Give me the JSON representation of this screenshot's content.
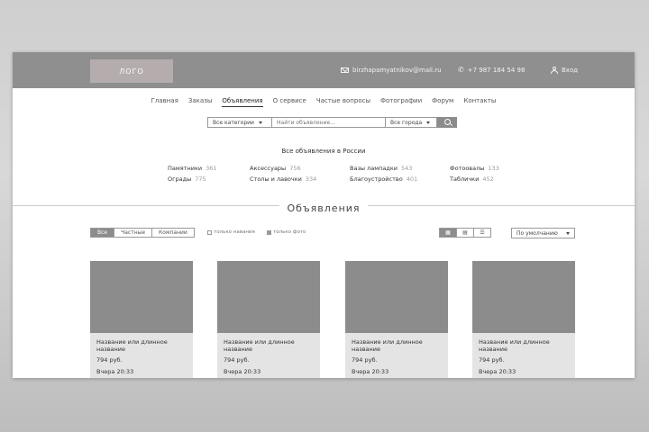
{
  "header": {
    "logo": "ЛОГО",
    "email": "birzhapamyatnikov@mail.ru",
    "phone": "+7 987 184 54 98",
    "login": "Вход"
  },
  "nav": [
    "Главная",
    "Заказы",
    "Объявления",
    "О сервисе",
    "Частые вопросы",
    "Фотографии",
    "Форум",
    "Контакты"
  ],
  "nav_active": "Объявления",
  "search": {
    "category": "Все категории",
    "placeholder": "Найти объявление...",
    "city": "Все города"
  },
  "russia": {
    "title": "Все объявления в России",
    "categories": [
      {
        "name": "Памятники",
        "count": "361"
      },
      {
        "name": "Аксессуары",
        "count": "756"
      },
      {
        "name": "Вазы лампадки",
        "count": "543"
      },
      {
        "name": "Фотоовалы",
        "count": "133"
      },
      {
        "name": "Ограды",
        "count": "775"
      },
      {
        "name": "Столы и лавочки",
        "count": "334"
      },
      {
        "name": "Благоустройство",
        "count": "401"
      },
      {
        "name": "Таблички",
        "count": "452"
      }
    ]
  },
  "section_title": "Объявления",
  "filters": {
    "tabs": [
      "Все",
      "Частные",
      "Компании"
    ],
    "active_tab": "Все",
    "only_listings": "только навания",
    "only_photo": "только фото",
    "sort": "По умолчанию"
  },
  "listings": [
    {
      "title": "Название или длинное название",
      "price": "794 руб.",
      "time": "Вчера 20:33"
    },
    {
      "title": "Название или длинное название",
      "price": "794 руб.",
      "time": "Вчера 20:33"
    },
    {
      "title": "Название или длинное название",
      "price": "794 руб.",
      "time": "Вчера 20:33"
    },
    {
      "title": "Название или длинное название",
      "price": "794 руб.",
      "time": "Вчера 20:33"
    }
  ],
  "colors": {
    "header_bg": "#8f8f8f",
    "accent": "#8c8c8c",
    "logo_bg": "#b5adad",
    "card_bg": "#e4e4e4"
  }
}
